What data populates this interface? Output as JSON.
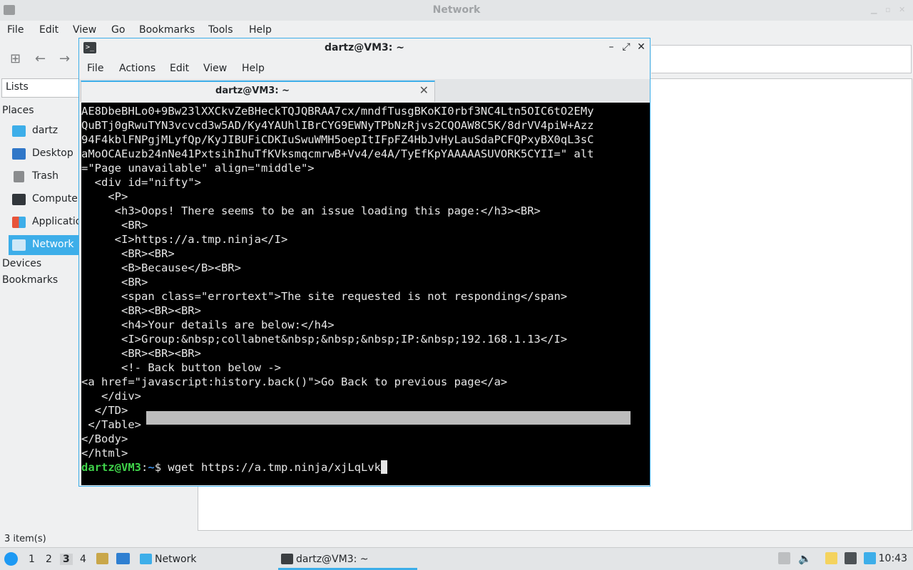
{
  "file_manager": {
    "title": "Network",
    "menu": [
      "File",
      "Edit",
      "View",
      "Go",
      "Bookmarks",
      "Tools",
      "Help"
    ],
    "side_pane_mode": "Lists",
    "sections": {
      "places": "Places",
      "devices": "Devices",
      "bookmarks": "Bookmarks"
    },
    "places": [
      {
        "label": "dartz",
        "icon": "home-folder-icon"
      },
      {
        "label": "Desktop",
        "icon": "desktop-icon"
      },
      {
        "label": "Trash",
        "icon": "trash-icon"
      },
      {
        "label": "Computer",
        "icon": "computer-icon"
      },
      {
        "label": "Applications",
        "icon": "applications-icon"
      },
      {
        "label": "Network",
        "icon": "network-icon",
        "selected": true
      }
    ],
    "status": "3 item(s)"
  },
  "terminal": {
    "title": "dartz@VM3: ~",
    "menu": [
      "File",
      "Actions",
      "Edit",
      "View",
      "Help"
    ],
    "tab_label": "dartz@VM3: ~",
    "lines": [
      "AE8DbeBHLo0+9Bw23lXXCkvZeBHeckTQJQBRAA7cx/mndfTusgBKoKI0rbf3NC4Ltn5OIC6tO2EMy",
      "QuBTj0gRwuTYN3vcvcd3w5AD/Ky4YAUhlIBrCYG9EWNyTPbNzRjvs2CQOAW8C5K/8drVV4piW+Azz",
      "94F4kblFNPgjMLyfQp/KyJIBUFiCDKIuSwuWMH5oepItIFpFZ4HbJvHyLauSdaPCFQPxyBX0qL3sC",
      "aMoOCAEuzb24nNe41PxtsihIhuTfKVksmqcmrwB+Vv4/e4A/TyEfKpYAAAAASUVORK5CYII=\" alt",
      "=\"Page unavailable\" align=\"middle\">",
      "  <div id=\"nifty\">",
      "    <P>",
      "     <h3>Oops! There seems to be an issue loading this page:</h3><BR>",
      "      <BR>",
      "     <I>https://a.tmp.ninja</I>",
      "      <BR><BR>",
      "      <B>Because</B><BR>",
      "      <BR>",
      "      <span class=\"errortext\">The site requested is not responding</span>",
      "      <BR><BR><BR>",
      "      <h4>Your details are below:</h4>",
      "      <I>Group:&nbsp;collabnet&nbsp;&nbsp;&nbsp;IP:&nbsp;192.168.1.13</I>",
      "      <BR><BR><BR>",
      "      <!- Back button below ->",
      "<a href=\"javascript:history.back()\">Go Back to previous page</a>",
      "   </div>",
      "  </TD>",
      " </Table>",
      "</Body>",
      "</html>"
    ],
    "prompt_user": "dartz@VM3",
    "prompt_sep": ":",
    "prompt_path": "~",
    "prompt_symbol": "$",
    "command": " wget https://a.tmp.ninja/xjLqLvk"
  },
  "taskbar": {
    "workspaces": [
      "1",
      "2",
      "3",
      "4"
    ],
    "current_workspace": "3",
    "tasks": [
      {
        "label": "Network",
        "icon": "folder-icon"
      },
      {
        "label": "dartz@VM3: ~",
        "icon": "terminal-icon",
        "active": true
      }
    ],
    "clock": "10:43"
  },
  "colors": {
    "accent": "#3daee9",
    "terminal_bg": "#000000",
    "prompt_user": "#3fd24a",
    "prompt_path": "#3a8ee6"
  }
}
